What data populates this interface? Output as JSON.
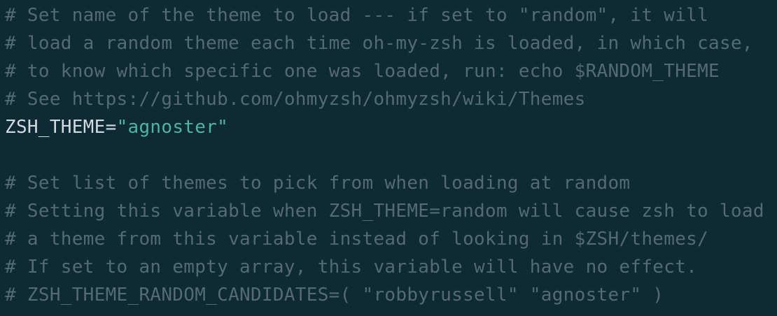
{
  "colors": {
    "background": "#0e2a35",
    "comment": "#566a73",
    "text": "#d3dadf",
    "string": "#4fb3a6"
  },
  "editor": {
    "lines": [
      {
        "text": "# Set name of the theme to load --- if set to \"random\", it will"
      },
      {
        "text": "# load a random theme each time oh-my-zsh is loaded, in which case,"
      },
      {
        "text": "# to know which specific one was loaded, run: echo $RANDOM_THEME"
      },
      {
        "text": "# See https://github.com/ohmyzsh/ohmyzsh/wiki/Themes"
      },
      {
        "var": "ZSH_THEME",
        "op": "=",
        "value": "\"agnoster\""
      },
      {
        "text": ""
      },
      {
        "text": "# Set list of themes to pick from when loading at random"
      },
      {
        "text": "# Setting this variable when ZSH_THEME=random will cause zsh to load"
      },
      {
        "text": "# a theme from this variable instead of looking in $ZSH/themes/"
      },
      {
        "text": "# If set to an empty array, this variable will have no effect."
      },
      {
        "text": "# ZSH_THEME_RANDOM_CANDIDATES=( \"robbyrussell\" \"agnoster\" )"
      }
    ]
  }
}
